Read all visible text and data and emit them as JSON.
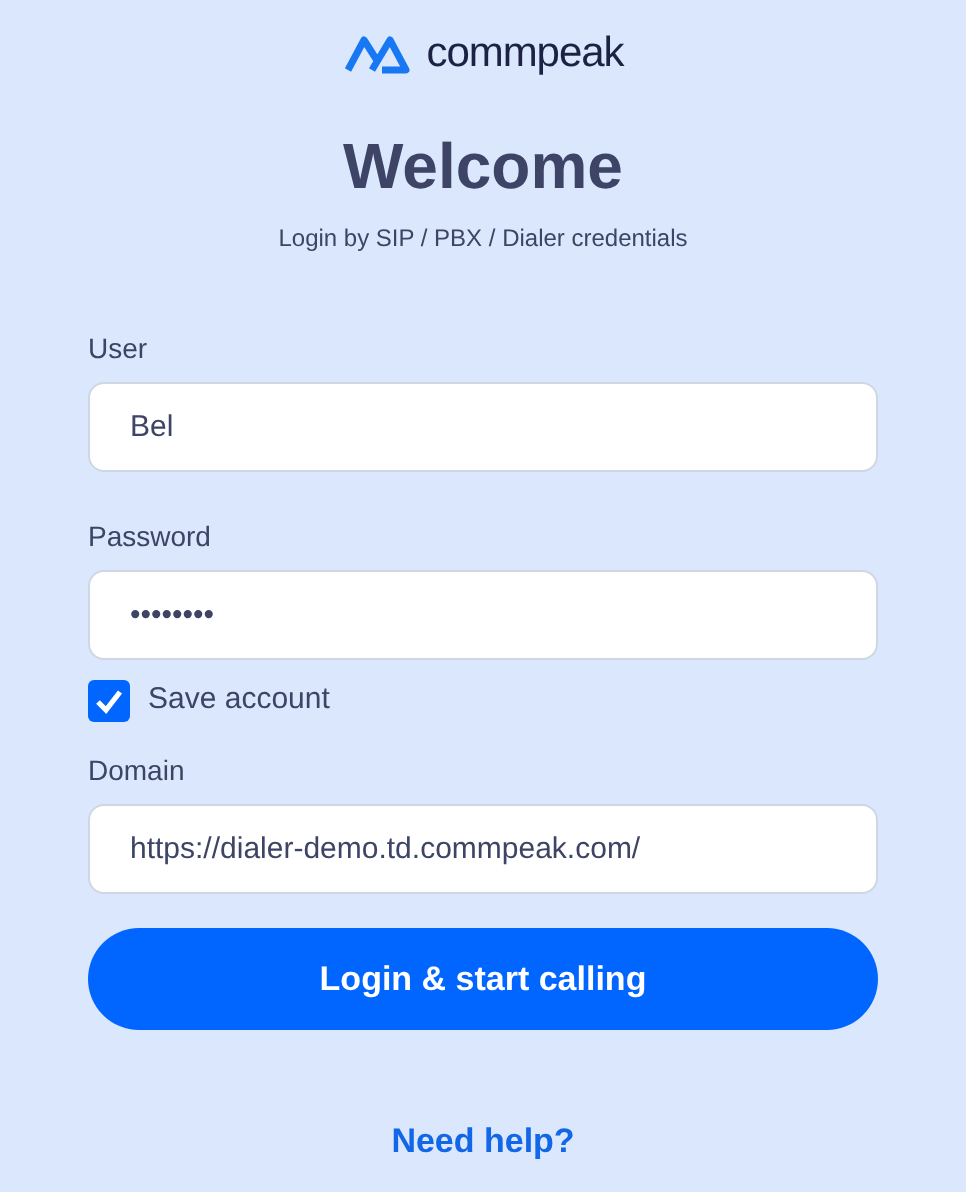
{
  "logo": {
    "text": "commpeak"
  },
  "title": "Welcome",
  "subtitle": "Login by SIP / PBX / Dialer credentials",
  "fields": [
    {
      "label": "User",
      "value": "Bel"
    },
    {
      "label": "Password",
      "value": "••••••••"
    }
  ],
  "save_account": {
    "label": "Save account",
    "checked": true
  },
  "domain": {
    "label": "Domain",
    "value": "https://dialer-demo.td.commpeak.com/"
  },
  "login_button": "Login & start calling",
  "help_link": "Need help?"
}
